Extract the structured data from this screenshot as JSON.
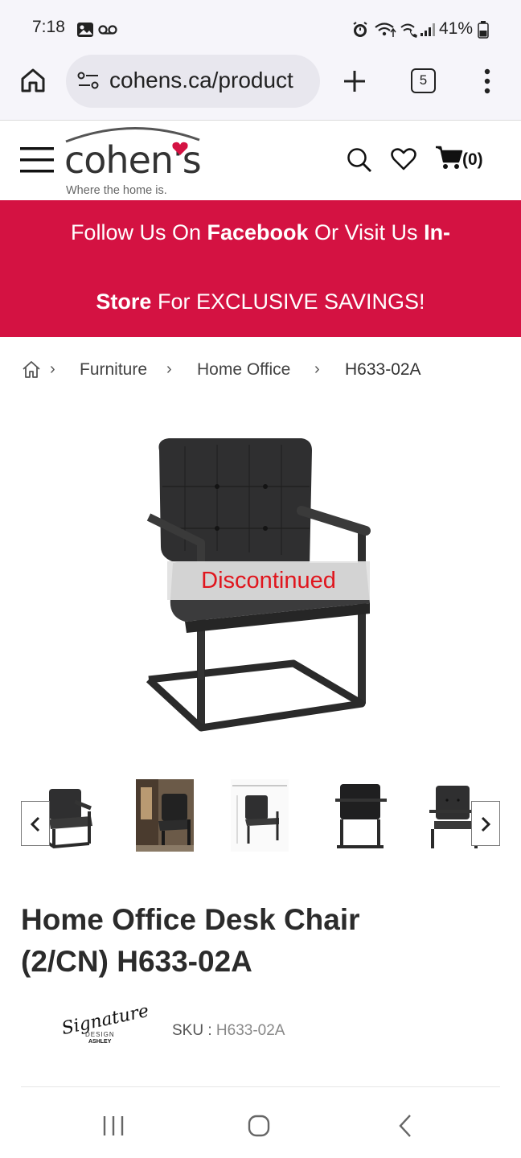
{
  "status_bar": {
    "time": "7:18",
    "battery": "41%",
    "icons": [
      "gallery-icon",
      "voicemail-icon",
      "alarm-icon",
      "wifi-icon",
      "wifi-call-icon",
      "signal-icon",
      "battery-icon"
    ]
  },
  "browser": {
    "url": "cohens.ca/product",
    "tab_count": "5",
    "icons": [
      "home-icon",
      "site-settings-icon",
      "new-tab-plus-icon",
      "tab-switcher-icon",
      "more-menu-icon"
    ]
  },
  "site_header": {
    "logo_text": "cohen's",
    "tagline": "Where the home is.",
    "cart_count": "(0)",
    "icons": [
      "hamburger-menu-icon",
      "search-icon",
      "heart-icon",
      "cart-icon"
    ],
    "colors": {
      "logo_heart": "#d41242",
      "logo_text": "#333333"
    }
  },
  "promo": {
    "line1_a": "Follow Us On ",
    "line1_b": "Facebook",
    "line1_c": " Or Visit Us ",
    "line1_d": "In-",
    "line2_a": "Store",
    "line2_b": " For EXCLUSIVE SAVINGS!",
    "background": "#d41242"
  },
  "breadcrumb": {
    "items": [
      "Furniture",
      "Home Office",
      "H633-02A"
    ]
  },
  "product": {
    "status_overlay": "Discontinued",
    "title_line1": "Home Office Desk Chair",
    "title_line2": "(2/CN) H633-02A",
    "sku_label": "SKU : ",
    "sku_value": "H633-02A",
    "brand_logo_text": [
      "Signature",
      "DESIGN",
      "ASHLEY"
    ],
    "thumbnail_count": 5
  },
  "nav_bar": {
    "icons": [
      "recent-apps-icon",
      "home-button-icon",
      "back-icon"
    ]
  }
}
